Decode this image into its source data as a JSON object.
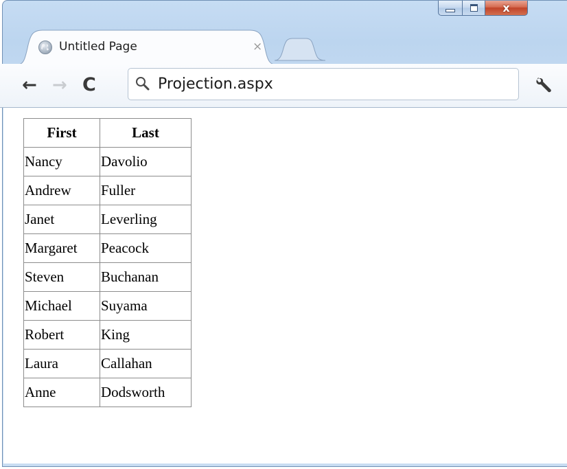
{
  "window": {
    "controls": {
      "minimize_icon": "minimize-icon",
      "maximize_icon": "maximize-icon",
      "close_label": "x"
    }
  },
  "tab": {
    "title": "Untitled Page",
    "close_label": "×",
    "favicon": "globe-icon"
  },
  "toolbar": {
    "back_label": "←",
    "forward_label": "→",
    "reload_label": "C",
    "address": "Projection.aspx",
    "search_icon": "search-icon",
    "menu_icon": "wrench-icon"
  },
  "table": {
    "headers": [
      "First",
      "Last"
    ],
    "rows": [
      [
        "Nancy",
        "Davolio"
      ],
      [
        "Andrew",
        "Fuller"
      ],
      [
        "Janet",
        "Leverling"
      ],
      [
        "Margaret",
        "Peacock"
      ],
      [
        "Steven",
        "Buchanan"
      ],
      [
        "Michael",
        "Suyama"
      ],
      [
        "Robert",
        "King"
      ],
      [
        "Laura",
        "Callahan"
      ],
      [
        "Anne",
        "Dodsworth"
      ]
    ]
  }
}
